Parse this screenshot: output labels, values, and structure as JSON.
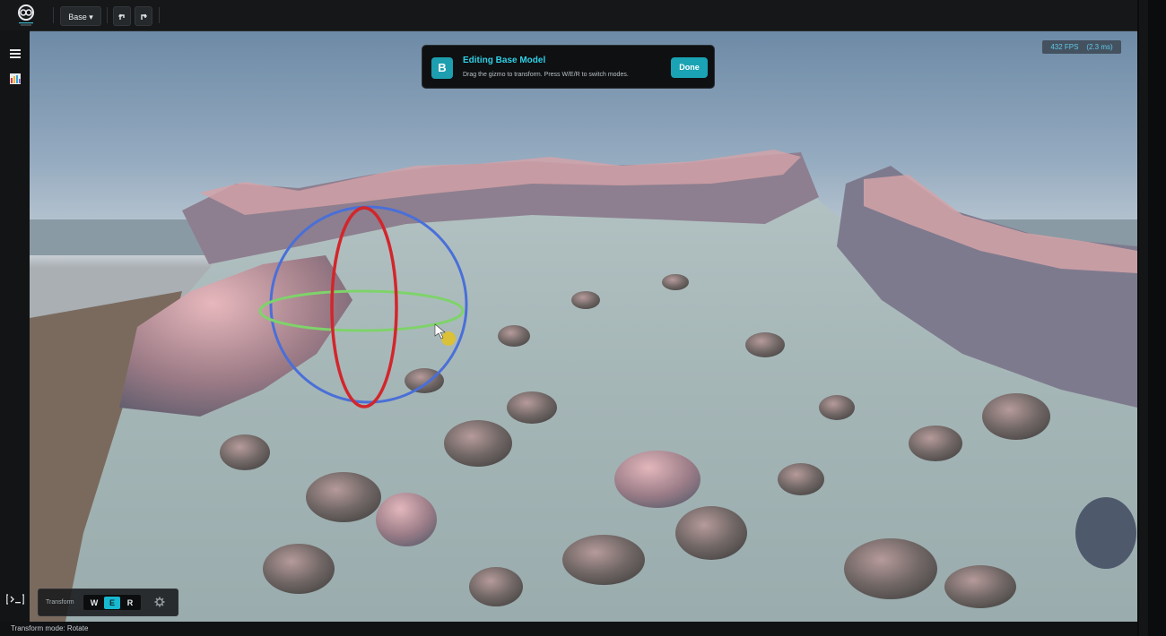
{
  "toolbar": {
    "model_dropdown_label": "Base ▾",
    "undo_icon": "undo-icon",
    "redo_icon": "redo-icon"
  },
  "sidebar": {
    "menu_icon": "hamburger-menu-icon",
    "layers_icon": "colored-bars-icon"
  },
  "banner": {
    "badge": "B",
    "title": "Editing Base Model",
    "subtitle": "Drag the gizmo to transform. Press W/E/R to switch modes.",
    "done_label": "Done"
  },
  "fps": {
    "text": "432 FPS    (2.3 ms)"
  },
  "transform": {
    "label": "Transform",
    "modes": [
      "W",
      "E",
      "R"
    ],
    "active_mode": "E",
    "settings_icon": "gear-icon"
  },
  "status": {
    "text": "Transform mode: Rotate"
  },
  "colors": {
    "accent": "#1aa3b4",
    "accent_text": "#2fd0e6",
    "gizmo_x": "#d2262c",
    "gizmo_y": "#7ed36a",
    "gizmo_z": "#4a6fd8"
  }
}
